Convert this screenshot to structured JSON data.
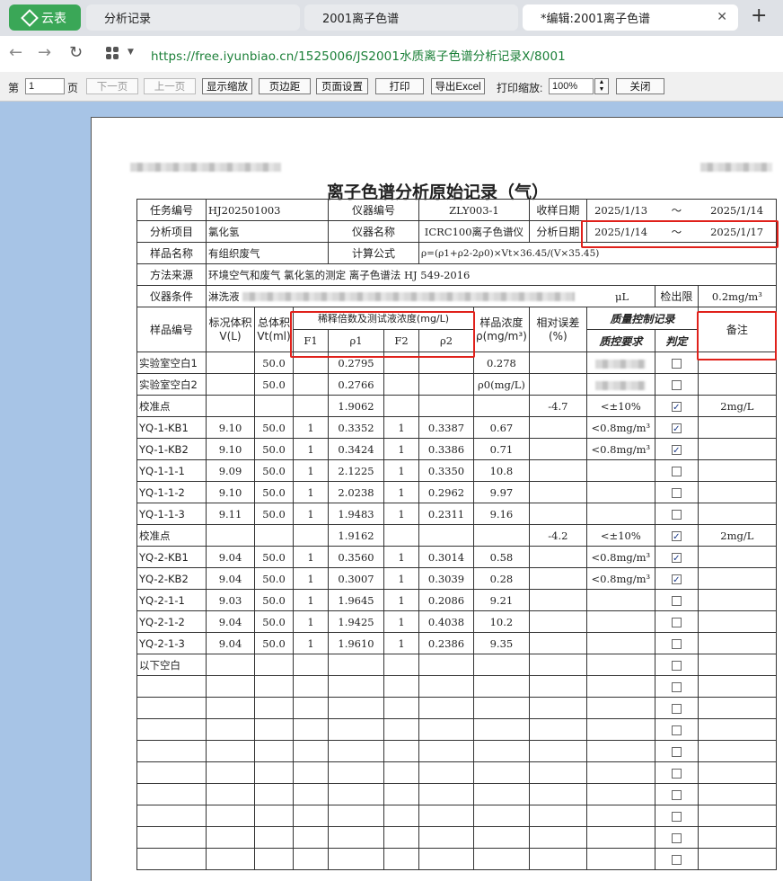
{
  "browser": {
    "logo_label": "云表",
    "tabs": [
      {
        "label": "分析记录"
      },
      {
        "label": "2001离子色谱"
      },
      {
        "label": "*编辑:2001离子色谱"
      }
    ],
    "new_tab": "+",
    "close": "✕",
    "url": "https://free.iyunbiao.cn/1525006/JS2001水质离子色谱分析记录X/8001"
  },
  "toolbar": {
    "page_prefix": "第",
    "page_value": "1",
    "page_suffix": "页",
    "next": "下一页",
    "prev": "上一页",
    "fit_zoom": "显示缩放",
    "margins": "页边距",
    "page_setup": "页面设置",
    "print": "打印",
    "export_excel": "导出Excel",
    "print_zoom_label": "打印缩放:",
    "print_zoom_value": "100%",
    "close": "关闭"
  },
  "record": {
    "title": "离子色谱分析原始记录（气）",
    "task_no_label": "任务编号",
    "task_no": "HJ202501003",
    "inst_no_label": "仪器编号",
    "inst_no": "ZLY003-1",
    "recv_date_label": "收样日期",
    "recv_from": "2025/1/13",
    "tilde": "～",
    "recv_to": "2025/1/14",
    "item_label": "分析项目",
    "item": "氯化氢",
    "inst_name_label": "仪器名称",
    "inst_name": "ICRC100离子色谱仪",
    "anal_date_label": "分析日期",
    "anal_from": "2025/1/14",
    "anal_to": "2025/1/17",
    "sample_name_label": "样品名称",
    "sample_name": "有组织废气",
    "formula_label": "计算公式",
    "formula": "ρ=(ρ1+ρ2-2ρ0)×Vt×36.45/(V×35.45)",
    "method_label": "方法来源",
    "method": "环境空气和废气 氯化氢的测定 离子色谱法 HJ 549-2016",
    "cond_label": "仪器条件",
    "cond_start": "淋洗液",
    "cond_end": "μL",
    "lod_label": "检出限",
    "lod": "0.2mg/m³",
    "h_sample_no": "样品编号",
    "h_std_vol_1": "标况体积",
    "h_std_vol_2": "V(L)",
    "h_tot_vol_1": "总体积",
    "h_tot_vol_2": "Vt(ml)",
    "h_dilution": "稀释倍数及测试液浓度(mg/L)",
    "h_f1": "F1",
    "h_p1": "ρ1",
    "h_f2": "F2",
    "h_p2": "ρ2",
    "h_conc_1": "样品浓度",
    "h_conc_2": "ρ(mg/m³)",
    "h_err_1": "相对误差",
    "h_err_2": "(%)",
    "h_qc": "质量控制记录",
    "h_qc_req": "质控要求",
    "h_qc_judge": "判定",
    "h_remark": "备注",
    "rows": [
      {
        "id": "实验室空白1",
        "v": "",
        "vt": "50.0",
        "f1": "",
        "p1": "0.2795",
        "f2": "",
        "p2": "",
        "conc": "0.278",
        "err": "",
        "req": "",
        "checked": false,
        "remark": "",
        "blurreq": true
      },
      {
        "id": "实验室空白2",
        "v": "",
        "vt": "50.0",
        "f1": "",
        "p1": "0.2766",
        "f2": "",
        "p2": "",
        "conc": "ρ0(mg/L)",
        "err": "",
        "req": "",
        "checked": false,
        "remark": "",
        "blurreq": true
      },
      {
        "id": "校准点",
        "v": "",
        "vt": "",
        "f1": "",
        "p1": "1.9062",
        "f2": "",
        "p2": "",
        "conc": "",
        "err": "-4.7",
        "req": "<±10%",
        "checked": true,
        "remark": "2mg/L"
      },
      {
        "id": "YQ-1-KB1",
        "v": "9.10",
        "vt": "50.0",
        "f1": "1",
        "p1": "0.3352",
        "f2": "1",
        "p2": "0.3387",
        "conc": "0.67",
        "err": "",
        "req": "<0.8mg/m³",
        "checked": true,
        "remark": ""
      },
      {
        "id": "YQ-1-KB2",
        "v": "9.10",
        "vt": "50.0",
        "f1": "1",
        "p1": "0.3424",
        "f2": "1",
        "p2": "0.3386",
        "conc": "0.71",
        "err": "",
        "req": "<0.8mg/m³",
        "checked": true,
        "remark": ""
      },
      {
        "id": "YQ-1-1-1",
        "v": "9.09",
        "vt": "50.0",
        "f1": "1",
        "p1": "2.1225",
        "f2": "1",
        "p2": "0.3350",
        "conc": "10.8",
        "err": "",
        "req": "",
        "checked": false,
        "remark": ""
      },
      {
        "id": "YQ-1-1-2",
        "v": "9.10",
        "vt": "50.0",
        "f1": "1",
        "p1": "2.0238",
        "f2": "1",
        "p2": "0.2962",
        "conc": "9.97",
        "err": "",
        "req": "",
        "checked": false,
        "remark": ""
      },
      {
        "id": "YQ-1-1-3",
        "v": "9.11",
        "vt": "50.0",
        "f1": "1",
        "p1": "1.9483",
        "f2": "1",
        "p2": "0.2311",
        "conc": "9.16",
        "err": "",
        "req": "",
        "checked": false,
        "remark": ""
      },
      {
        "id": "校准点",
        "v": "",
        "vt": "",
        "f1": "",
        "p1": "1.9162",
        "f2": "",
        "p2": "",
        "conc": "",
        "err": "-4.2",
        "req": "<±10%",
        "checked": true,
        "remark": "2mg/L"
      },
      {
        "id": "YQ-2-KB1",
        "v": "9.04",
        "vt": "50.0",
        "f1": "1",
        "p1": "0.3560",
        "f2": "1",
        "p2": "0.3014",
        "conc": "0.58",
        "err": "",
        "req": "<0.8mg/m³",
        "checked": true,
        "remark": ""
      },
      {
        "id": "YQ-2-KB2",
        "v": "9.04",
        "vt": "50.0",
        "f1": "1",
        "p1": "0.3007",
        "f2": "1",
        "p2": "0.3039",
        "conc": "0.28",
        "err": "",
        "req": "<0.8mg/m³",
        "checked": true,
        "remark": ""
      },
      {
        "id": "YQ-2-1-1",
        "v": "9.03",
        "vt": "50.0",
        "f1": "1",
        "p1": "1.9645",
        "f2": "1",
        "p2": "0.2086",
        "conc": "9.21",
        "err": "",
        "req": "",
        "checked": false,
        "remark": ""
      },
      {
        "id": "YQ-2-1-2",
        "v": "9.04",
        "vt": "50.0",
        "f1": "1",
        "p1": "1.9425",
        "f2": "1",
        "p2": "0.4038",
        "conc": "10.2",
        "err": "",
        "req": "",
        "checked": false,
        "remark": ""
      },
      {
        "id": "YQ-2-1-3",
        "v": "9.04",
        "vt": "50.0",
        "f1": "1",
        "p1": "1.9610",
        "f2": "1",
        "p2": "0.2386",
        "conc": "9.35",
        "err": "",
        "req": "",
        "checked": false,
        "remark": ""
      },
      {
        "id": "以下空白",
        "v": "",
        "vt": "",
        "f1": "",
        "p1": "",
        "f2": "",
        "p2": "",
        "conc": "",
        "err": "",
        "req": "",
        "checked": false,
        "remark": ""
      },
      {
        "id": "",
        "v": "",
        "vt": "",
        "f1": "",
        "p1": "",
        "f2": "",
        "p2": "",
        "conc": "",
        "err": "",
        "req": "",
        "checked": false,
        "remark": ""
      },
      {
        "id": "",
        "v": "",
        "vt": "",
        "f1": "",
        "p1": "",
        "f2": "",
        "p2": "",
        "conc": "",
        "err": "",
        "req": "",
        "checked": false,
        "remark": ""
      },
      {
        "id": "",
        "v": "",
        "vt": "",
        "f1": "",
        "p1": "",
        "f2": "",
        "p2": "",
        "conc": "",
        "err": "",
        "req": "",
        "checked": false,
        "remark": ""
      },
      {
        "id": "",
        "v": "",
        "vt": "",
        "f1": "",
        "p1": "",
        "f2": "",
        "p2": "",
        "conc": "",
        "err": "",
        "req": "",
        "checked": false,
        "remark": ""
      },
      {
        "id": "",
        "v": "",
        "vt": "",
        "f1": "",
        "p1": "",
        "f2": "",
        "p2": "",
        "conc": "",
        "err": "",
        "req": "",
        "checked": false,
        "remark": ""
      },
      {
        "id": "",
        "v": "",
        "vt": "",
        "f1": "",
        "p1": "",
        "f2": "",
        "p2": "",
        "conc": "",
        "err": "",
        "req": "",
        "checked": false,
        "remark": ""
      },
      {
        "id": "",
        "v": "",
        "vt": "",
        "f1": "",
        "p1": "",
        "f2": "",
        "p2": "",
        "conc": "",
        "err": "",
        "req": "",
        "checked": false,
        "remark": ""
      },
      {
        "id": "",
        "v": "",
        "vt": "",
        "f1": "",
        "p1": "",
        "f2": "",
        "p2": "",
        "conc": "",
        "err": "",
        "req": "",
        "checked": false,
        "remark": ""
      },
      {
        "id": "",
        "v": "",
        "vt": "",
        "f1": "",
        "p1": "",
        "f2": "",
        "p2": "",
        "conc": "",
        "err": "",
        "req": "",
        "checked": false,
        "remark": ""
      }
    ]
  },
  "colors": {
    "highlight": "#e0211b",
    "url": "#1a7f37",
    "logo": "#3aa757",
    "doc_bg": "#a7c4e6"
  }
}
